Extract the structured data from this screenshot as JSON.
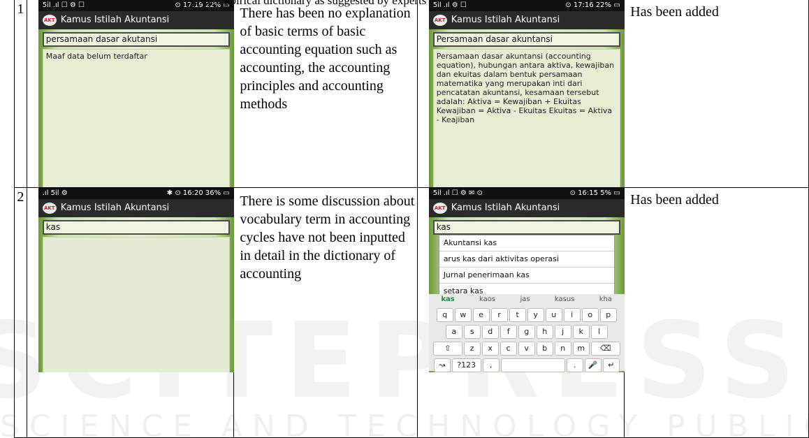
{
  "caption": "xt on empirical dictionary as suggested by experts",
  "rows": [
    {
      "number": "1",
      "description": "There has been no explanation of basic terms of basic accounting equation such as accounting, the accounting principles and accounting methods",
      "status": "Has been added",
      "before": {
        "status_left": "5il .ıl ☐ ⚙ ☐",
        "status_right": "⊙ 17:19 22% ▭",
        "app_title": "Kamus Istilah Akuntansi",
        "search_value": "persamaan dasar akutansi",
        "result_text": "Maaf data belum terdaftar"
      },
      "after": {
        "status_left": "5il .ıl ⚙ ☐",
        "status_right": "⊙ 17:16 22% ▭",
        "app_title": "Kamus Istilah Akuntansi",
        "search_value": "Persamaan dasar akuntansi",
        "result_text": "Persamaan dasar akuntansi (accounting equation), hubungan antara aktiva, kewajiban dan ekuitas dalam bentuk persamaan matematika yang merupakan inti dari pencatatan akuntansi, kesamaan tersebut adalah: Aktiva = Kewajiban + Ekuitas Kewajiban = Aktiva - Ekuitas Ekuitas = Aktiva - Keajiban"
      }
    },
    {
      "number": "2",
      "description": "There is some discussion about vocabulary term in accounting cycles have not been inputted in detail in the dictionary of accounting",
      "status": "Has been added",
      "before": {
        "status_left": ".ıl 5il ⚙",
        "status_right": "✱ ⊙ 16:20 36% ▭",
        "app_title": "Kamus Istilah Akuntansi",
        "search_value": "kas"
      },
      "after": {
        "status_left": "5il .ıl ☐ ⚙ ✉ ⊙",
        "status_right": "⊙ 16:15 5% ▭",
        "app_title": "Kamus Istilah Akuntansi",
        "search_value": "kas",
        "suggestions": [
          "Akuntansi kas",
          "arus kas dari aktivitas operasi",
          "Jurnal penerimaan kas",
          "setara kas"
        ],
        "keyboard_suggestions": [
          "kas",
          "kaos",
          "jas",
          "kasus",
          "kha"
        ],
        "keyboard_rows": [
          [
            "q",
            "w",
            "e",
            "r",
            "t",
            "y",
            "u",
            "i",
            "o",
            "p"
          ],
          [
            "a",
            "s",
            "d",
            "f",
            "g",
            "h",
            "j",
            "k",
            "l"
          ],
          [
            "⇧",
            "z",
            "x",
            "c",
            "v",
            "b",
            "n",
            "m",
            "⌫"
          ],
          [
            "↝",
            "?123",
            ",",
            "",
            ".",
            "🎤",
            "↵"
          ]
        ]
      }
    }
  ],
  "app_icon_text": "AKT",
  "watermark_big": "SCITEPRESS",
  "watermark_small": "SCIENCE AND TECHNOLOGY PUBLICATIONS"
}
